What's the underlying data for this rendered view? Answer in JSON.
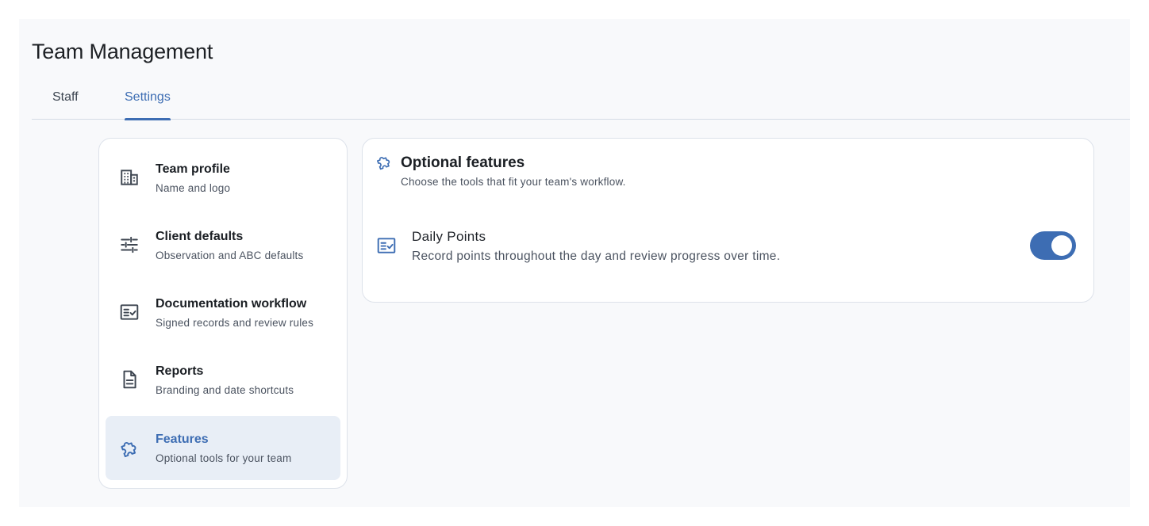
{
  "header": {
    "title": "Team Management"
  },
  "tabs": [
    {
      "label": "Staff",
      "active": false
    },
    {
      "label": "Settings",
      "active": true
    }
  ],
  "sidebar": {
    "items": [
      {
        "icon": "building-icon",
        "title": "Team profile",
        "subtitle": "Name and logo"
      },
      {
        "icon": "sliders-icon",
        "title": "Client defaults",
        "subtitle": "Observation and ABC defaults"
      },
      {
        "icon": "checklist-icon",
        "title": "Documentation workflow",
        "subtitle": "Signed records and review rules"
      },
      {
        "icon": "document-icon",
        "title": "Reports",
        "subtitle": "Branding and date shortcuts"
      },
      {
        "icon": "puzzle-icon",
        "title": "Features",
        "subtitle": "Optional tools for your team",
        "active": true
      }
    ]
  },
  "panel": {
    "icon": "puzzle-icon",
    "title": "Optional features",
    "subtitle": "Choose the tools that fit your team's workflow.",
    "features": [
      {
        "icon": "checklist-icon",
        "name": "Daily Points",
        "description": "Record points throughout the day and review progress over time.",
        "enabled": true
      }
    ]
  },
  "colors": {
    "accent": "#3d6db3",
    "active_nav_bg": "#e8eef6",
    "page_bg": "#f8f9fb",
    "border": "#dde2ea"
  }
}
